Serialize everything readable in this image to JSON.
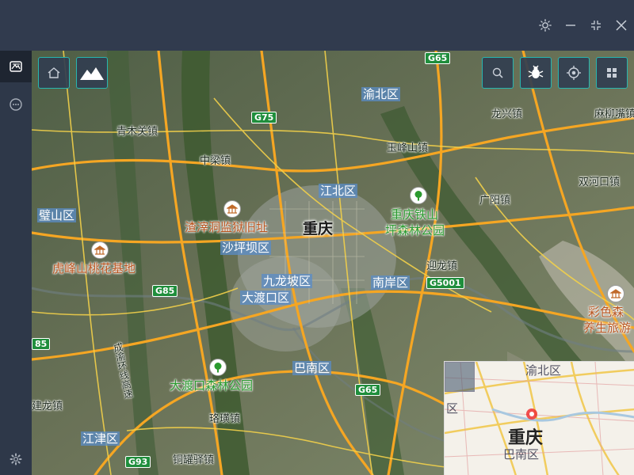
{
  "titlebar": {
    "buttons": [
      {
        "name": "theme-toggle-button",
        "icon": "sun-icon"
      },
      {
        "name": "minimize-button",
        "icon": "minimize-icon"
      },
      {
        "name": "fullscreen-button",
        "icon": "fullscreen-icon"
      },
      {
        "name": "close-button",
        "icon": "close-icon"
      }
    ]
  },
  "sidebar": {
    "items": [
      {
        "name": "sidebar-item-map",
        "icon": "map-icon",
        "active": true
      },
      {
        "name": "sidebar-item-chat",
        "icon": "chat-bubble-icon",
        "active": false
      }
    ],
    "footer": {
      "name": "sidebar-settings",
      "icon": "gear-icon"
    }
  },
  "map_toolbar_left": [
    {
      "name": "home-button",
      "icon": "home-icon"
    },
    {
      "name": "terrain-button",
      "icon": "mountain-icon"
    }
  ],
  "map_toolbar_right": [
    {
      "name": "search-button",
      "icon": "search-icon"
    },
    {
      "name": "layer-style-button",
      "icon": "bug-icon"
    },
    {
      "name": "locate-button",
      "icon": "target-icon"
    },
    {
      "name": "grid-button",
      "icon": "grid-icon"
    }
  ],
  "map": {
    "labels": {
      "yubei": "渝北区",
      "longxing": "龙兴镇",
      "maliu": "麻柳嘴镇",
      "qingmu": "青木关镇",
      "zhongliang": "中梁镇",
      "yufengshan": "玉峰山镇",
      "shuanghe": "双河口镇",
      "guangyang": "广阳镇",
      "bishan": "璧山区",
      "jiangbei": "江北区",
      "tieshan_park_1": "重庆铁山",
      "tieshan_park_2": "坪森林公园",
      "zhazidong": "渣滓洞监狱旧址",
      "chongqing": "重庆",
      "shapingba": "沙坪坝区",
      "hufeng": "虎峰山桃花基地",
      "yinglong": "迎龙镇",
      "jiulongpo": "九龙坡区",
      "nanan": "南岸区",
      "dadukou": "大渡口区",
      "caise_1": "彩色森",
      "caise_2": "养生旅游",
      "chengyu": "成渝环线高速",
      "banan": "巴南区",
      "dadukou_park": "大渡口森林公园",
      "jianlong": "建龙镇",
      "luohuang": "珞璜镇",
      "jiangjin": "江津区",
      "tongguanyi": "铜罐驿镇"
    },
    "shields": {
      "g65_top": "G65",
      "g75": "G75",
      "g85": "G85",
      "g85_left": "85",
      "g5001": "G5001",
      "g65_bottom": "G65",
      "g93": "G93"
    }
  },
  "minimap": {
    "labels": {
      "yubei": "渝北区",
      "chongqing": "重庆",
      "banan": "巴南区",
      "qu_left": "区"
    }
  },
  "colors": {
    "accent": "#27b6b0",
    "titlebar": "#313b4e",
    "sidebar": "#2e3849",
    "district_label_bg": "#5a8cc8",
    "highway_shield": "#1f8e3c",
    "road_major": "#f5a623",
    "road_minor": "#f2d04a"
  }
}
